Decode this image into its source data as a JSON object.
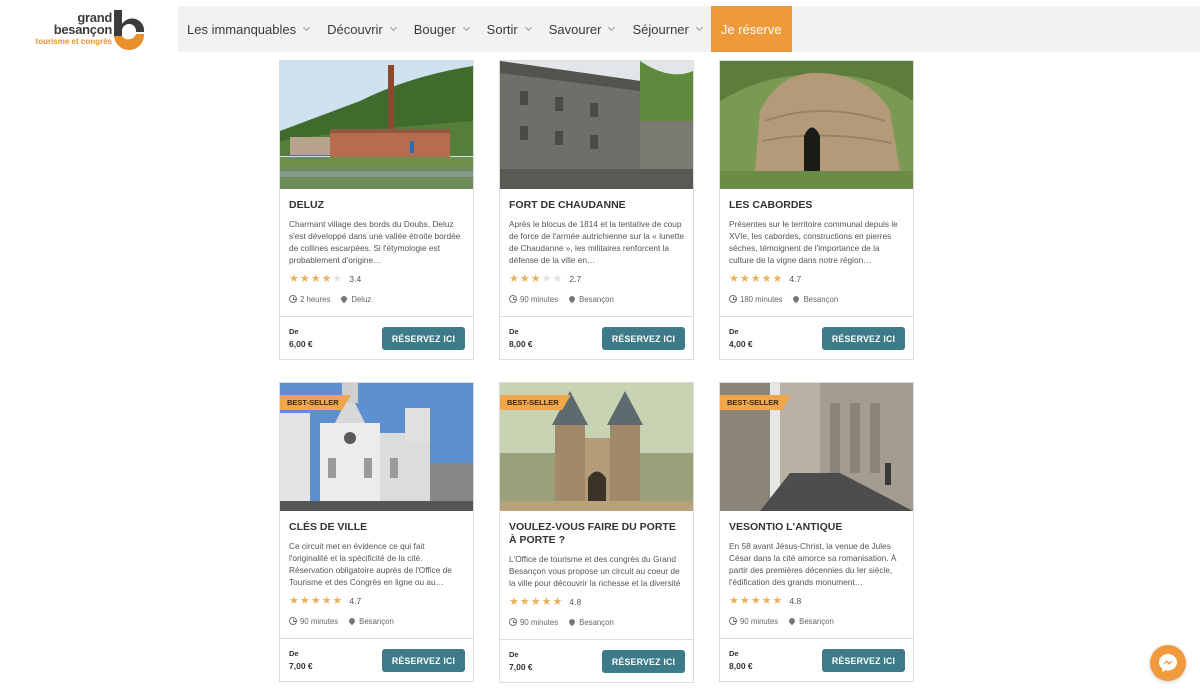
{
  "logo": {
    "line1": "grand",
    "line2": "besançon",
    "line3": "tourisme et congrès"
  },
  "nav": {
    "items": [
      "Les immanquables",
      "Découvrir",
      "Bouger",
      "Sortir",
      "Savourer",
      "Séjourner"
    ],
    "cta": "Je réserve"
  },
  "cards": [
    {
      "title": "DELUZ",
      "badge": "",
      "desc": "Charmant village des bords du Doubs, Deluz s'est développé dans une vallée étroite bordée de collines escarpées. Si l'étymologie est probablement d'origine…",
      "rating": 3.4,
      "score": "3.4",
      "duration": "2 heures",
      "location": "Deluz",
      "from": "De",
      "price": "6,00 €",
      "button": "RÉSERVEZ ICI"
    },
    {
      "title": "FORT DE CHAUDANNE",
      "badge": "",
      "desc": "Après le blocus de 1814 et la tentative de coup de force de l'armée autrichienne sur la « lunette de Chaudanne », les militaires renforcent la défense de la ville en…",
      "rating": 2.7,
      "score": "2.7",
      "duration": "90 minutes",
      "location": "Besançon",
      "from": "De",
      "price": "8,00 €",
      "button": "RÉSERVEZ ICI"
    },
    {
      "title": "LES CABORDES",
      "badge": "",
      "desc": "Présentes sur le territoire communal depuis le XVIe, les cabordes, constructions en pierres sèches, témoignent de l'importance de la culture de la vigne dans notre région…",
      "rating": 4.7,
      "score": "4.7",
      "duration": "180 minutes",
      "location": "Besançon",
      "from": "De",
      "price": "4,00 €",
      "button": "RÉSERVEZ ICI"
    },
    {
      "title": "CLÉS DE VILLE",
      "badge": "BEST-SELLER",
      "desc": "Ce circuit met en évidence ce qui fait l'originalité et la spécificité de la cité. Réservation obligatoire auprès de l'Office de Tourisme et des Congrès en ligne ou au…",
      "rating": 4.7,
      "score": "4.7",
      "duration": "90 minutes",
      "location": "Besançon",
      "from": "De",
      "price": "7,00 €",
      "button": "RÉSERVEZ ICI"
    },
    {
      "title": "VOULEZ-VOUS FAIRE DU PORTE À PORTE ?",
      "badge": "BEST-SELLER",
      "desc": "L'Office de tourisme et des congrès du Grand Besançon vous propose un circuit au coeur de la ville pour découvrir la richesse et la diversité des portes bisontines.",
      "rating": 4.8,
      "score": "4.8",
      "duration": "90 minutes",
      "location": "Besançon",
      "from": "De",
      "price": "7,00 €",
      "button": "RÉSERVEZ ICI"
    },
    {
      "title": "VESONTIO L'ANTIQUE",
      "badge": "BEST-SELLER",
      "desc": "En 58 avant Jésus-Christ, la venue de Jules César dans la cité amorce sa romanisation. À partir des premières décennies du Ier siècle, l'édification des grands monument…",
      "rating": 4.8,
      "score": "4.8",
      "duration": "90 minutes",
      "location": "Besançon",
      "from": "De",
      "price": "8,00 €",
      "button": "RÉSERVEZ ICI"
    }
  ],
  "colors": {
    "accent": "#ee9a3a",
    "button": "#3d7b88",
    "star": "#e9b15c",
    "badge": "#f0a64a"
  }
}
